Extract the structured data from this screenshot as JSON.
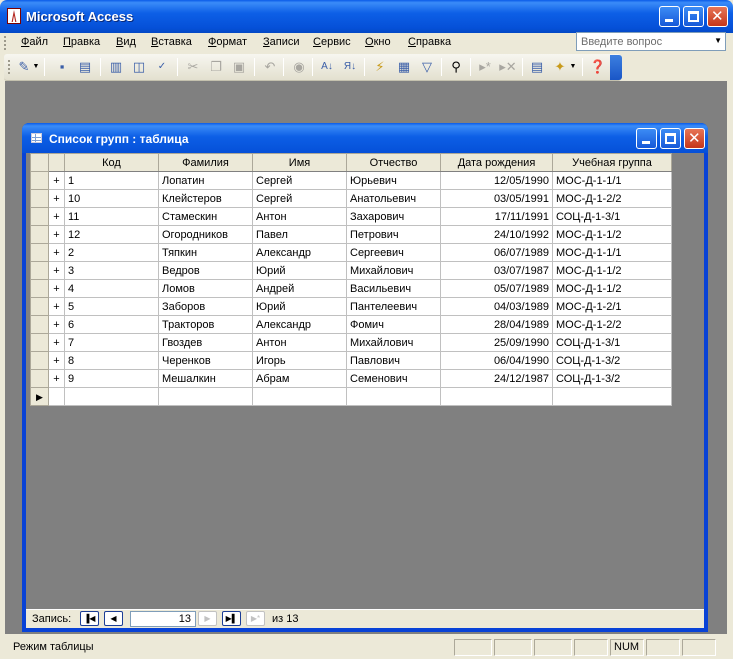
{
  "app": {
    "title": "Microsoft Access",
    "ask_placeholder": "Введите вопрос"
  },
  "menu": [
    "Файл",
    "Правка",
    "Вид",
    "Вставка",
    "Формат",
    "Записи",
    "Сервис",
    "Окно",
    "Справка"
  ],
  "toolbar_icons": [
    "view-icon",
    "save-icon",
    "search-file-icon",
    "print-icon",
    "print-preview-icon",
    "spelling-icon",
    "cut-icon",
    "copy-icon",
    "paste-icon",
    "undo-icon",
    "hyperlink-icon",
    "sort-ascending-icon",
    "sort-descending-icon",
    "filter-by-selection-icon",
    "filter-by-form-icon",
    "apply-filter-icon",
    "find-icon",
    "new-record-icon",
    "delete-record-icon",
    "properties-icon",
    "new-object-icon",
    "help-icon"
  ],
  "table_window": {
    "title": "Список групп : таблица",
    "columns": [
      "Код",
      "Фамилия",
      "Имя",
      "Отчество",
      "Дата рождения",
      "Учебная группа"
    ],
    "rows": [
      [
        "1",
        "Лопатин",
        "Сергей",
        "Юрьевич",
        "12/05/1990",
        "МОС-Д-1-1/1"
      ],
      [
        "10",
        "Клейстеров",
        "Сергей",
        "Анатольевич",
        "03/05/1991",
        "МОС-Д-1-2/2"
      ],
      [
        "11",
        "Стамескин",
        "Антон",
        "Захарович",
        "17/11/1991",
        "СОЦ-Д-1-3/1"
      ],
      [
        "12",
        "Огородников",
        "Павел",
        "Петрович",
        "24/10/1992",
        "МОС-Д-1-1/2"
      ],
      [
        "2",
        "Тяпкин",
        "Александр",
        "Сергеевич",
        "06/07/1989",
        "МОС-Д-1-1/1"
      ],
      [
        "3",
        "Ведров",
        "Юрий",
        "Михайлович",
        "03/07/1987",
        "МОС-Д-1-1/2"
      ],
      [
        "4",
        "Ломов",
        "Андрей",
        "Васильевич",
        "05/07/1989",
        "МОС-Д-1-1/2"
      ],
      [
        "5",
        "Заборов",
        "Юрий",
        "Пантелеевич",
        "04/03/1989",
        "МОС-Д-1-2/1"
      ],
      [
        "6",
        "Тракторов",
        "Александр",
        "Фомич",
        "28/04/1989",
        "МОС-Д-1-2/2"
      ],
      [
        "7",
        "Гвоздев",
        "Антон",
        "Михайлович",
        "25/09/1990",
        "СОЦ-Д-1-3/1"
      ],
      [
        "8",
        "Черенков",
        "Игорь",
        "Павлович",
        "06/04/1990",
        "СОЦ-Д-1-3/2"
      ],
      [
        "9",
        "Мешалкин",
        "Абрам",
        "Семенович",
        "24/12/1987",
        "СОЦ-Д-1-3/2"
      ]
    ],
    "expand_glyph": "+"
  },
  "navigation": {
    "label": "Запись:",
    "current_record": "13",
    "of_label": "из 13"
  },
  "status": {
    "text": "Режим таблицы",
    "num_indicator": "NUM"
  }
}
